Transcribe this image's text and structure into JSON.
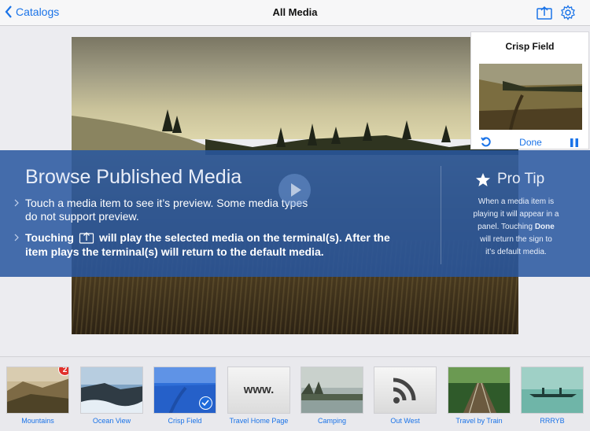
{
  "navbar": {
    "back_label": "Catalogs",
    "title": "All Media",
    "icons": [
      "upload-icon",
      "gear-icon"
    ]
  },
  "side_panel": {
    "title": "Crisp Field",
    "done_label": "Done"
  },
  "overlay": {
    "title": "Browse Published Media",
    "line1a": "Touch a media item to see it’s preview. Some media types",
    "line1b": "do not support preview.",
    "line2_bold_a": "Touching",
    "line2_bold_b": "will play the selected media on the terminal(s). After the",
    "line2_bold_c": "item plays the terminal(s) will return to the default media.",
    "tip_title": "Pro Tip",
    "tip_1": "When a media item is",
    "tip_2": "playing it will appear in a",
    "tip_3a": "panel. Touching",
    "tip_3b": "Done",
    "tip_4": "will return the sign to",
    "tip_5": "it’s default media."
  },
  "media_items": [
    {
      "label": "Mountains",
      "badge": "2"
    },
    {
      "label": "Ocean View"
    },
    {
      "label": "Crisp Field",
      "selected": true
    },
    {
      "label": "Travel Home Page",
      "thumb_text": "www."
    },
    {
      "label": "Camping"
    },
    {
      "label": "Out West"
    },
    {
      "label": "Travel by Train"
    },
    {
      "label": "RRRYB"
    }
  ],
  "colors": {
    "accent": "#1a73e8",
    "overlay": "#2856a0",
    "badge": "#e0302b"
  }
}
